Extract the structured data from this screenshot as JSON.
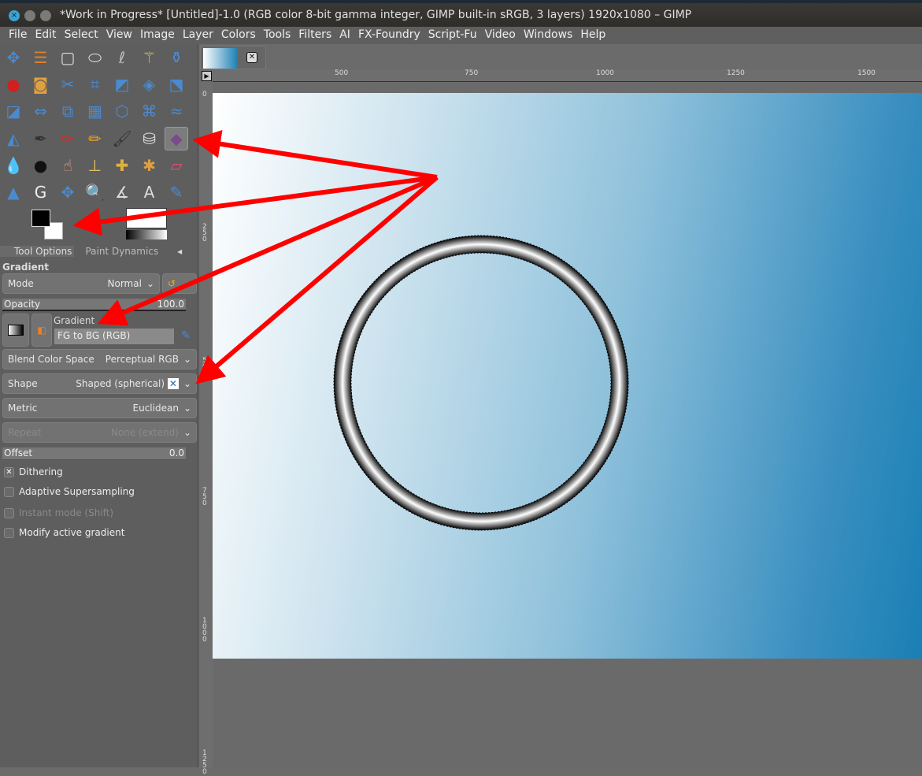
{
  "window": {
    "title": "*Work in Progress* [Untitled]-1.0 (RGB color 8-bit gamma integer, GIMP built-in sRGB, 3 layers) 1920x1080 – GIMP"
  },
  "menu": [
    "File",
    "Edit",
    "Select",
    "View",
    "Image",
    "Layer",
    "Colors",
    "Tools",
    "Filters",
    "AI",
    "FX-Foundry",
    "Script-Fu",
    "Video",
    "Windows",
    "Help"
  ],
  "tools": [
    [
      "move",
      "align",
      "rect-select",
      "ellipse-select",
      "free-select",
      "fuzzy-select",
      "paths-select"
    ],
    [
      "color-select",
      "foreground-select",
      "scissors",
      "crop",
      "unified-transform",
      "perspective",
      "flip"
    ],
    [
      "cage",
      "warp",
      "handle",
      "grid",
      "n-point",
      "perspective-clone",
      "seamless"
    ],
    [
      "text-path",
      "ink",
      "color-picker",
      "pencil",
      "paintbrush",
      "bucket-fill",
      "gradient"
    ],
    [
      "blur",
      "airbrush",
      "smudge",
      "clone",
      "heal",
      "dodge",
      "eraser"
    ],
    [
      "levels",
      "gegl",
      "move-2",
      "zoom",
      "measure",
      "text",
      "mypaint"
    ]
  ],
  "tool_options": {
    "tabs": [
      "Tool Options",
      "Paint Dynamics"
    ],
    "section": "Gradient",
    "mode_label": "Mode",
    "mode_value": "Normal",
    "opacity_label": "Opacity",
    "opacity_value": "100.0",
    "gradient_label": "Gradient",
    "gradient_value": "FG to BG (RGB)",
    "blend_label": "Blend Color Space",
    "blend_value": "Perceptual RGB",
    "shape_label": "Shape",
    "shape_value": "Shaped (spherical)",
    "metric_label": "Metric",
    "metric_value": "Euclidean",
    "repeat_label": "Repeat",
    "repeat_value": "None (extend)",
    "offset_label": "Offset",
    "offset_value": "0.0",
    "checks": [
      {
        "label": "Dithering",
        "checked": true
      },
      {
        "label": "Adaptive Supersampling",
        "checked": false
      },
      {
        "label": "Instant mode  (Shift)",
        "checked": false
      },
      {
        "label": "Modify active gradient",
        "checked": false
      }
    ]
  },
  "ruler": {
    "h": [
      "500",
      "750",
      "1000",
      "1250",
      "1500"
    ],
    "v": [
      "0",
      "250",
      "500",
      "750",
      "1000",
      "1250"
    ]
  },
  "colors": {
    "annotation": "#ff0000",
    "canvas_end": "#1a7fb5"
  }
}
